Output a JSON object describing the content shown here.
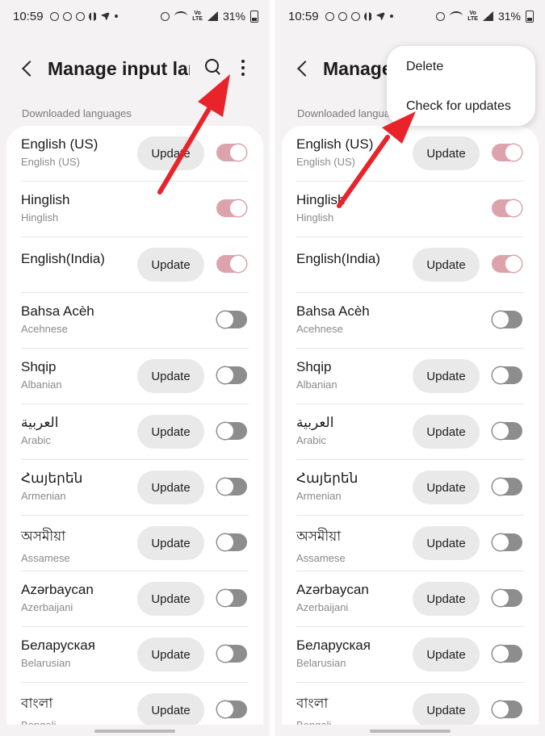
{
  "status_bar": {
    "time": "10:59",
    "battery": "31%"
  },
  "header": {
    "title": "Manage input languages"
  },
  "section_label": "Downloaded languages",
  "update_label": "Update",
  "menu": {
    "items": [
      "Delete",
      "Check for updates"
    ]
  },
  "languages": [
    {
      "name": "English (US)",
      "sub": "English (US)",
      "update": true,
      "enabled": true
    },
    {
      "name": "Hinglish",
      "sub": "Hinglish",
      "update": false,
      "enabled": true
    },
    {
      "name": "English(India)",
      "sub": "",
      "update": true,
      "enabled": true
    },
    {
      "name": "Bahsa Acèh",
      "sub": "Acehnese",
      "update": false,
      "enabled": false
    },
    {
      "name": "Shqip",
      "sub": "Albanian",
      "update": true,
      "enabled": false
    },
    {
      "name": "العربية",
      "sub": "Arabic",
      "update": true,
      "enabled": false
    },
    {
      "name": "Հայերեն",
      "sub": "Armenian",
      "update": true,
      "enabled": false
    },
    {
      "name": "অসমীয়া",
      "sub": "Assamese",
      "update": true,
      "enabled": false
    },
    {
      "name": "Azərbaycan",
      "sub": "Azerbaijani",
      "update": true,
      "enabled": false
    },
    {
      "name": "Беларуская",
      "sub": "Belarusian",
      "update": true,
      "enabled": false
    },
    {
      "name": "বাংলা",
      "sub": "Bengali",
      "update": true,
      "enabled": false
    }
  ],
  "colors": {
    "toggle_on": "#dca3ad",
    "toggle_off": "#8d8d8d",
    "arrow": "#e8232a",
    "background": "#f4f2f3"
  }
}
